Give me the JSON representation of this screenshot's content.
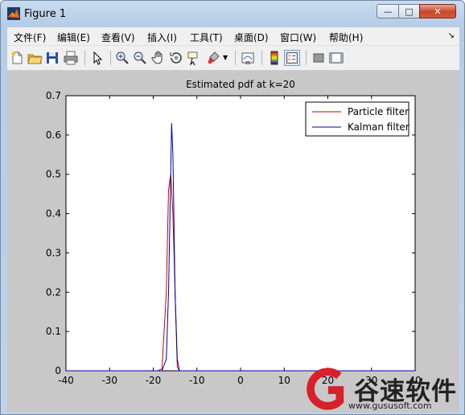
{
  "window": {
    "title": "Figure 1",
    "controls": {
      "minimize": "—",
      "maximize": "□",
      "close": "✕"
    }
  },
  "menu": {
    "items": [
      "文件(F)",
      "编辑(E)",
      "查看(V)",
      "插入(I)",
      "工具(T)",
      "桌面(D)",
      "窗口(W)",
      "帮助(H)"
    ]
  },
  "toolbar": {
    "icons": [
      "new-figure-icon",
      "open-file-icon",
      "save-icon",
      "print-icon",
      "select-arrow-icon",
      "zoom-in-icon",
      "zoom-out-icon",
      "pan-hand-icon",
      "rotate-3d-icon",
      "data-cursor-icon",
      "brush-icon",
      "dropdown-icon",
      "link-plot-icon",
      "insert-colorbar-icon",
      "insert-legend-icon",
      "hide-plot-tools-icon",
      "show-plot-tools-icon"
    ],
    "selected": "insert-legend-icon"
  },
  "chart_data": {
    "type": "line",
    "title": "Estimated pdf at k=20",
    "xlabel": "",
    "ylabel": "",
    "xlim": [
      -40,
      40
    ],
    "ylim": [
      0,
      0.7
    ],
    "xticks": [
      "-40",
      "-30",
      "-20",
      "-10",
      "0",
      "10",
      "20",
      "30",
      "40"
    ],
    "yticks": [
      "0",
      "0.1",
      "0.2",
      "0.3",
      "0.4",
      "0.5",
      "0.6",
      "0.7"
    ],
    "legend_position": "top-right",
    "grid": false,
    "series": [
      {
        "name": "Particle filter",
        "color": "#cc0000",
        "x": [
          -40,
          -19,
          -18,
          -17,
          -16.5,
          -16,
          -15.5,
          -15,
          -14.5,
          -14,
          -13,
          40
        ],
        "y": [
          0,
          0,
          0.005,
          0.2,
          0.46,
          0.5,
          0.4,
          0.2,
          0.01,
          0,
          0,
          0
        ]
      },
      {
        "name": "Kalman filter",
        "color": "#0000aa",
        "x": [
          -40,
          -18,
          -17,
          -16.5,
          -16,
          -15.8,
          -15.5,
          -15,
          -14.5,
          -14,
          -13,
          -11,
          40
        ],
        "y": [
          0,
          0,
          0.03,
          0.2,
          0.5,
          0.63,
          0.55,
          0.2,
          0.03,
          0,
          0,
          0,
          0
        ]
      }
    ]
  },
  "watermark": {
    "brand": "谷速软件",
    "url": "www.gususoft.com",
    "logo": "gusu-logo-icon"
  }
}
